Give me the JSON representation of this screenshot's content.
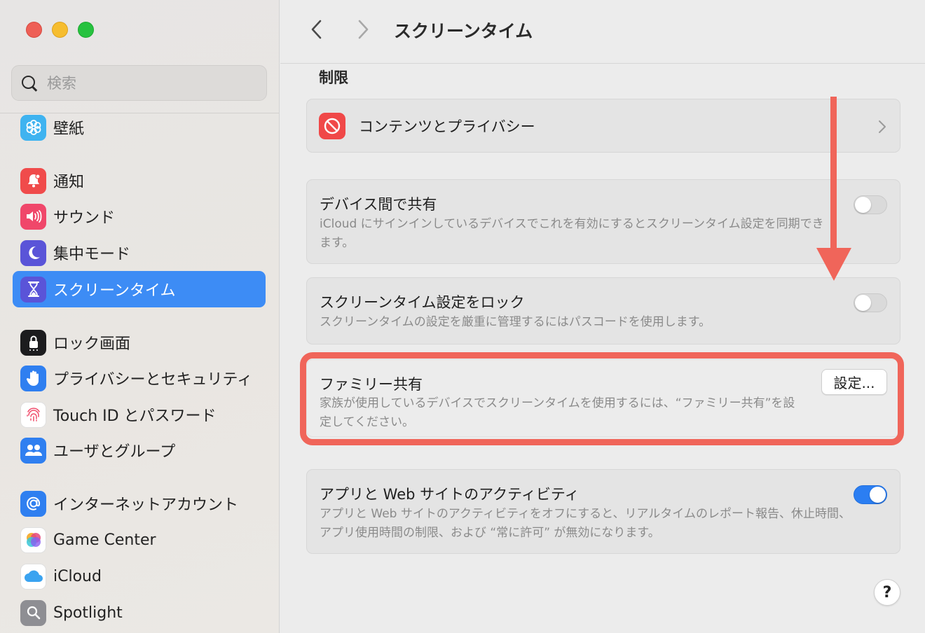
{
  "window": {
    "title": "スクリーンタイム"
  },
  "sidebar": {
    "search": {
      "placeholder": "検索",
      "value": ""
    },
    "items": [
      {
        "label": "壁紙",
        "icon": "wallpaper-icon",
        "color": "#3fb3f0"
      },
      {
        "label": "通知",
        "icon": "bell-icon",
        "color": "#f04b4b"
      },
      {
        "label": "サウンド",
        "icon": "speaker-icon",
        "color": "#f0476a"
      },
      {
        "label": "集中モード",
        "icon": "moon-icon",
        "color": "#5a54d8"
      },
      {
        "label": "スクリーンタイム",
        "icon": "hourglass-icon",
        "color": "#5a54d8",
        "active": true
      },
      {
        "label": "ロック画面",
        "icon": "lock-icon",
        "color": "#1c1c1e"
      },
      {
        "label": "プライバシーとセキュリティ",
        "icon": "hand-icon",
        "color": "#2f7ff0"
      },
      {
        "label": "Touch ID とパスワード",
        "icon": "fingerprint-icon",
        "color": "#ffffff"
      },
      {
        "label": "ユーザとグループ",
        "icon": "users-icon",
        "color": "#2f7ff0"
      },
      {
        "label": "インターネットアカウント",
        "icon": "at-icon",
        "color": "#2f7ff0"
      },
      {
        "label": "Game Center",
        "icon": "game-center-icon",
        "color": "#ffffff"
      },
      {
        "label": "iCloud",
        "icon": "cloud-icon",
        "color": "#ffffff"
      },
      {
        "label": "Spotlight",
        "icon": "magnifier-icon",
        "color": "#8e8e93"
      }
    ]
  },
  "main": {
    "section_title": "制限",
    "content_privacy": {
      "label": "コンテンツとプライバシー"
    },
    "share_devices": {
      "title": "デバイス間で共有",
      "desc": "iCloud にサインインしているデバイスでこれを有効にするとスクリーンタイム設定を同期できます。",
      "enabled": false
    },
    "lock_settings": {
      "title": "スクリーンタイム設定をロック",
      "desc": "スクリーンタイムの設定を厳重に管理するにはパスコードを使用します。",
      "enabled": false
    },
    "family_sharing": {
      "title": "ファミリー共有",
      "desc": "家族が使用しているデバイスでスクリーンタイムを使用するには、“ファミリー共有”を設定してください。",
      "button": "設定..."
    },
    "app_web_activity": {
      "title": "アプリと Web サイトのアクティビティ",
      "desc": "アプリと Web サイトのアクティビティをオフにすると、リアルタイムのレポート報告、休止時間、アプリ使用時間の制限、および “常に許可” が無効になります。",
      "enabled": true
    },
    "help": "?"
  },
  "colors": {
    "accent": "#3d8cf5",
    "annotation": "#f0655a",
    "toggle_on": "#2b7ef2"
  }
}
